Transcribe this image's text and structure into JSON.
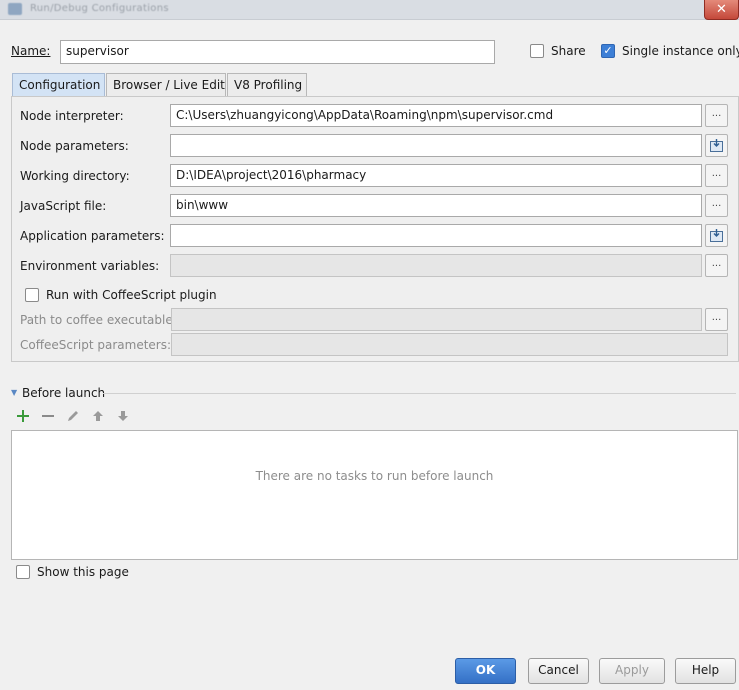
{
  "window": {
    "title": "Run/Debug Configurations",
    "close_glyph": "✕"
  },
  "name": {
    "label": "Name:",
    "value": "supervisor"
  },
  "options": {
    "share_label": "Share",
    "share_checked": false,
    "single_instance_label": "Single instance only",
    "single_instance_checked": true
  },
  "tabs": [
    {
      "label": "Configuration",
      "active": true
    },
    {
      "label": "Browser / Live Edit",
      "active": false
    },
    {
      "label": "V8 Profiling",
      "active": false
    }
  ],
  "config": {
    "node_interpreter": {
      "label": "Node interpreter:",
      "value": "C:\\Users\\zhuangyicong\\AppData\\Roaming\\npm\\supervisor.cmd"
    },
    "node_parameters": {
      "label": "Node parameters:",
      "value": ""
    },
    "working_directory": {
      "label": "Working directory:",
      "value": "D:\\IDEA\\project\\2016\\pharmacy"
    },
    "javascript_file": {
      "label": "JavaScript file:",
      "value": "bin\\www"
    },
    "application_parameters": {
      "label": "Application parameters:",
      "value": ""
    },
    "environment_variables": {
      "label": "Environment variables:",
      "value": ""
    },
    "coffeescript_checkbox_label": "Run with CoffeeScript plugin",
    "coffee_path": {
      "label": "Path to coffee executable:",
      "value": ""
    },
    "coffee_params": {
      "label": "CoffeeScript parameters:",
      "value": ""
    },
    "browse_glyph": "..."
  },
  "before_launch": {
    "label": "Before launch",
    "empty_text": "There are no tasks to run before launch",
    "toolbar_icons": [
      "add-icon",
      "remove-icon",
      "edit-icon",
      "move-up-icon",
      "move-down-icon"
    ]
  },
  "show_page": {
    "label": "Show this page",
    "checked": false
  },
  "buttons": {
    "ok": "OK",
    "cancel": "Cancel",
    "apply": "Apply",
    "help": "Help"
  },
  "colors": {
    "accent": "#3d7fd6",
    "add_icon": "#3a9a3a"
  }
}
